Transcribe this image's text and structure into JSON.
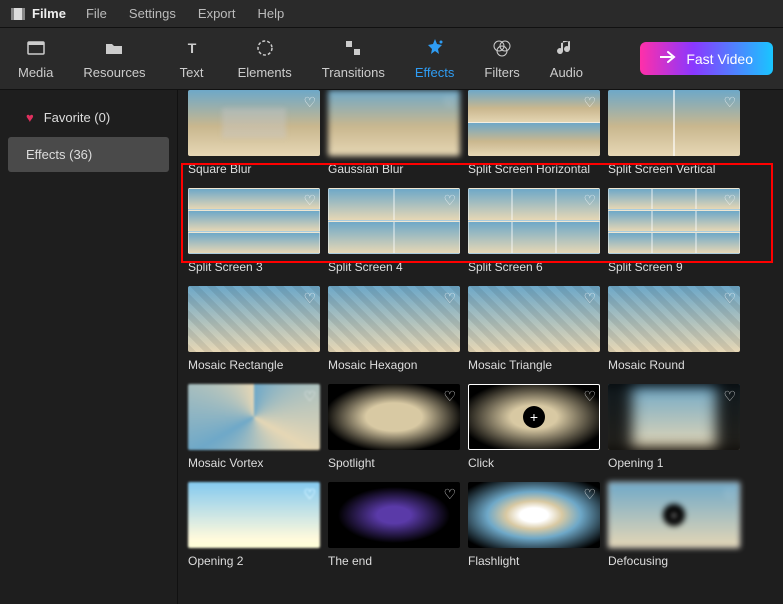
{
  "app": {
    "name": "Filme"
  },
  "menu": [
    "File",
    "Settings",
    "Export",
    "Help"
  ],
  "toolbar": [
    {
      "id": "media",
      "label": "Media"
    },
    {
      "id": "resources",
      "label": "Resources"
    },
    {
      "id": "text",
      "label": "Text"
    },
    {
      "id": "elements",
      "label": "Elements"
    },
    {
      "id": "transitions",
      "label": "Transitions"
    },
    {
      "id": "effects",
      "label": "Effects",
      "active": true
    },
    {
      "id": "filters",
      "label": "Filters"
    },
    {
      "id": "audio",
      "label": "Audio"
    }
  ],
  "fast_video": "Fast Video",
  "sidebar": {
    "favorite": {
      "label": "Favorite (0)"
    },
    "effects": {
      "label": "Effects (36)",
      "selected": true
    }
  },
  "effects": [
    {
      "name": "Square Blur",
      "style": "blur-sq"
    },
    {
      "name": "Gaussian Blur",
      "style": "blur-gauss"
    },
    {
      "name": "Split Screen Horizontal",
      "style": "split-h"
    },
    {
      "name": "Split Screen Vertical",
      "style": "split-v"
    },
    {
      "name": "Split Screen 3",
      "grid": "g3",
      "highlighted": true
    },
    {
      "name": "Split Screen 4",
      "grid": "g4",
      "highlighted": true
    },
    {
      "name": "Split Screen 6",
      "grid": "g6",
      "highlighted": true
    },
    {
      "name": "Split Screen 9",
      "grid": "g9",
      "highlighted": true
    },
    {
      "name": "Mosaic Rectangle",
      "style": "mosaic"
    },
    {
      "name": "Mosaic Hexagon",
      "style": "mosaic"
    },
    {
      "name": "Mosaic Triangle",
      "style": "mosaic"
    },
    {
      "name": "Mosaic Round",
      "style": "mosaic"
    },
    {
      "name": "Mosaic Vortex",
      "style": "vortex"
    },
    {
      "name": "Spotlight",
      "style": "spotlight"
    },
    {
      "name": "Click",
      "style": "click-bg",
      "selected": true,
      "plus": true
    },
    {
      "name": "Opening 1",
      "style": "opening1"
    },
    {
      "name": "Opening 2",
      "style": "opening2"
    },
    {
      "name": "The end",
      "style": "theend"
    },
    {
      "name": "Flashlight",
      "style": "flashlight"
    },
    {
      "name": "Defocusing",
      "style": "defocus",
      "selected": true,
      "plus": true
    }
  ]
}
